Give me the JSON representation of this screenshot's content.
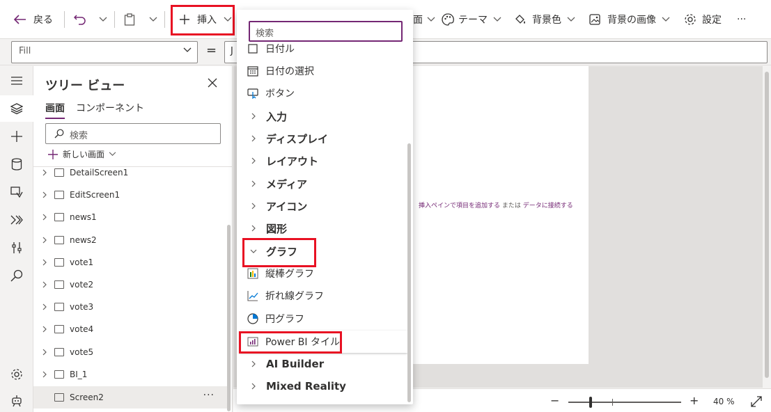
{
  "toolbar": {
    "back_label": "戻る",
    "insert_label": "挿入",
    "theme_label": "テーマ",
    "bg_color_label": "背景色",
    "bg_image_label": "背景の画像",
    "settings_label": "設定",
    "more_label": "···",
    "partial_label": "面"
  },
  "formula": {
    "property": "Fill",
    "equals": "=",
    "value": "J"
  },
  "tree": {
    "title": "ツリー ビュー",
    "tabs": [
      "画面",
      "コンポーネント"
    ],
    "search_placeholder": "検索",
    "new_screen_label": "新しい画面",
    "items": [
      "DetailScreen1",
      "EditScreen1",
      "news1",
      "news2",
      "vote1",
      "vote2",
      "vote3",
      "vote4",
      "vote5",
      "BI_1",
      "Screen2"
    ],
    "selected": "Screen2",
    "more": "···"
  },
  "insert_menu": {
    "search_placeholder": "検索",
    "partial_top": "日付ル",
    "items": [
      {
        "label": "日付の選択",
        "kind": "item",
        "icon": "calendar-icon"
      },
      {
        "label": "ボタン",
        "kind": "item",
        "icon": "button-icon"
      },
      {
        "label": "入力",
        "kind": "category",
        "icon": "chevron-right-icon"
      },
      {
        "label": "ディスプレイ",
        "kind": "category",
        "icon": "chevron-right-icon"
      },
      {
        "label": "レイアウト",
        "kind": "category",
        "icon": "chevron-right-icon"
      },
      {
        "label": "メディア",
        "kind": "category",
        "icon": "chevron-right-icon"
      },
      {
        "label": "アイコン",
        "kind": "category",
        "icon": "chevron-right-icon"
      },
      {
        "label": "図形",
        "kind": "category",
        "icon": "chevron-right-icon"
      },
      {
        "label": "グラフ",
        "kind": "category-open",
        "icon": "chevron-down-icon"
      },
      {
        "label": "縦棒グラフ",
        "kind": "item",
        "icon": "column-chart-icon"
      },
      {
        "label": "折れ線グラフ",
        "kind": "item",
        "icon": "line-chart-icon"
      },
      {
        "label": "円グラフ",
        "kind": "item",
        "icon": "pie-chart-icon"
      },
      {
        "label": "Power BI タイル",
        "kind": "item-highlight",
        "icon": "powerbi-icon"
      },
      {
        "label": "AI Builder",
        "kind": "category",
        "icon": "chevron-right-icon"
      },
      {
        "label": "Mixed Reality",
        "kind": "category",
        "icon": "chevron-right-icon"
      }
    ]
  },
  "canvas": {
    "hint_link1": "挿入ペインで項目を追加する",
    "hint_mid": "または",
    "hint_link2": "データに接続する"
  },
  "status": {
    "zoom_value": "40 %",
    "zoom_level": 0.2
  },
  "colors": {
    "accent": "#742774",
    "highlight_box": "#e81123"
  }
}
